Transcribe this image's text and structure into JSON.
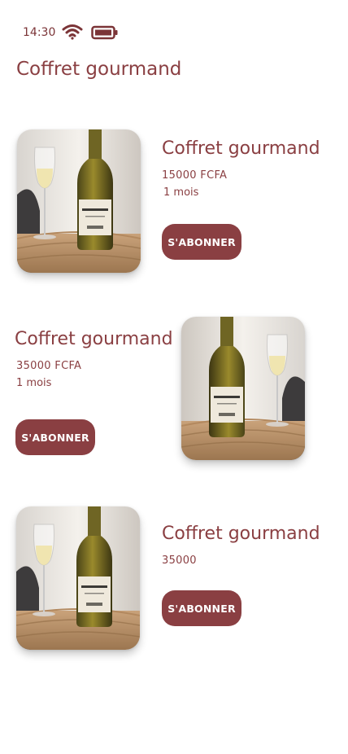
{
  "status_bar": {
    "time": "14:30",
    "wifi_icon": "wifi-icon",
    "battery_icon": "battery-icon"
  },
  "header": {
    "title": "Coffret gourmand"
  },
  "colors": {
    "accent": "#8a3f42",
    "background": "#ffffff",
    "button_text": "#ffffff"
  },
  "products": [
    {
      "name": "Coffret gourmand",
      "price": "15000  FCFA",
      "duration": "1 mois",
      "button_label": "S'ABONNER",
      "image": "wine-bottle-and-glass-photo"
    },
    {
      "name": "Coffret gourmand",
      "price": "35000  FCFA",
      "duration": "1 mois",
      "button_label": "S'ABONNER",
      "image": "wine-bottle-and-glass-photo"
    },
    {
      "name": "Coffret gourmand",
      "price": "35000",
      "duration": "",
      "button_label": "S'ABONNER",
      "image": "wine-bottle-and-glass-photo"
    }
  ]
}
